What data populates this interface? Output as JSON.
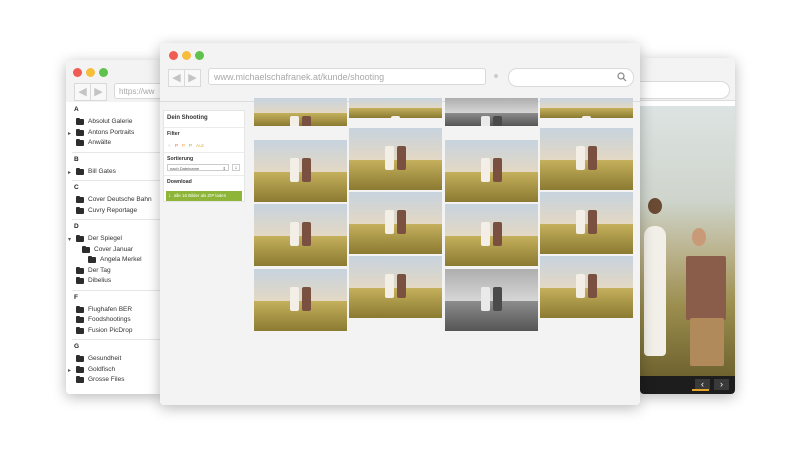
{
  "left_window": {
    "url": "https://ww",
    "sections": [
      {
        "letter": "A",
        "items": [
          {
            "label": "Absolut Galerie",
            "expandable": false,
            "indent": 0
          },
          {
            "label": "Antons Portraits",
            "expandable": true,
            "indent": 0
          },
          {
            "label": "Anwälte",
            "expandable": false,
            "indent": 0
          }
        ]
      },
      {
        "letter": "B",
        "items": [
          {
            "label": "Bill Gates",
            "expandable": true,
            "indent": 0
          }
        ]
      },
      {
        "letter": "C",
        "items": [
          {
            "label": "Cover Deutsche Bahn",
            "expandable": false,
            "indent": 0
          },
          {
            "label": "Cuvry Reportage",
            "expandable": false,
            "indent": 0
          }
        ]
      },
      {
        "letter": "D",
        "items": [
          {
            "label": "Der Spiegel",
            "expandable": true,
            "expanded": true,
            "indent": 0
          },
          {
            "label": "Cover Januar",
            "expandable": false,
            "indent": 1
          },
          {
            "label": "Angela Merkel",
            "expandable": false,
            "indent": 2
          },
          {
            "label": "Der Tag",
            "expandable": false,
            "indent": 0
          },
          {
            "label": "Dibelius",
            "expandable": false,
            "indent": 0
          }
        ]
      },
      {
        "letter": "F",
        "items": [
          {
            "label": "Flughafen BER",
            "expandable": false,
            "indent": 0
          },
          {
            "label": "Foodshootings",
            "expandable": false,
            "indent": 0
          },
          {
            "label": "Fusion PicDrop",
            "expandable": false,
            "indent": 0
          }
        ]
      },
      {
        "letter": "G",
        "items": [
          {
            "label": "Gesundheit",
            "expandable": false,
            "indent": 0
          },
          {
            "label": "Goldfisch",
            "expandable": true,
            "indent": 0
          },
          {
            "label": "Grosse Files",
            "expandable": false,
            "indent": 0
          }
        ]
      }
    ]
  },
  "main_window": {
    "url": "www.michaelschafranek.at/kunde/shooting",
    "sidebar": {
      "title": "Dein Shooting",
      "filter_label": "Filter",
      "filter_chips": [
        {
          "label": "×",
          "color": "#c8c8c8"
        },
        {
          "label": "P",
          "color": "#e06a5a"
        },
        {
          "label": "P",
          "color": "#f0a04a"
        },
        {
          "label": "P",
          "color": "#8eb538"
        },
        {
          "label": "Auz",
          "color": "#e0b040"
        }
      ],
      "sort_label": "Sortierung",
      "sort_value": "nach Dateiname",
      "sort_direction": "↓",
      "download_label": "Download",
      "download_button": "alle 16 Bilder als ZIP laden"
    },
    "photos": [
      {
        "col": 0,
        "row": 0,
        "tone": "color",
        "figures": 2
      },
      {
        "col": 0,
        "row": 1,
        "tone": "color",
        "figures": 2
      },
      {
        "col": 0,
        "row": 2,
        "tone": "color",
        "figures": 2
      },
      {
        "col": 0,
        "row": 3,
        "tone": "color",
        "figures": 2
      },
      {
        "col": 1,
        "row": 0,
        "tone": "color",
        "figures": 1
      },
      {
        "col": 1,
        "row": 1,
        "tone": "color",
        "figures": 2
      },
      {
        "col": 1,
        "row": 2,
        "tone": "color",
        "figures": 2
      },
      {
        "col": 1,
        "row": 3,
        "tone": "color",
        "figures": 2
      },
      {
        "col": 2,
        "row": 0,
        "tone": "bw",
        "figures": 2
      },
      {
        "col": 2,
        "row": 1,
        "tone": "color",
        "figures": 2
      },
      {
        "col": 2,
        "row": 2,
        "tone": "color",
        "figures": 2
      },
      {
        "col": 2,
        "row": 3,
        "tone": "bw",
        "figures": 2
      },
      {
        "col": 3,
        "row": 0,
        "tone": "color",
        "figures": 1
      },
      {
        "col": 3,
        "row": 1,
        "tone": "color",
        "figures": 2
      },
      {
        "col": 3,
        "row": 2,
        "tone": "color",
        "figures": 2
      },
      {
        "col": 3,
        "row": 3,
        "tone": "color",
        "figures": 2
      }
    ]
  },
  "right_window": {
    "prev_icon": "chevron-left-icon",
    "next_icon": "chevron-right-icon",
    "prev_glyph": "‹",
    "next_glyph": "›"
  },
  "colors": {
    "traffic_red": "#f05b52",
    "traffic_yellow": "#f7bd3b",
    "traffic_green": "#5ec24c",
    "download_green": "#8eb538",
    "slider_accent": "#e5a42a"
  }
}
